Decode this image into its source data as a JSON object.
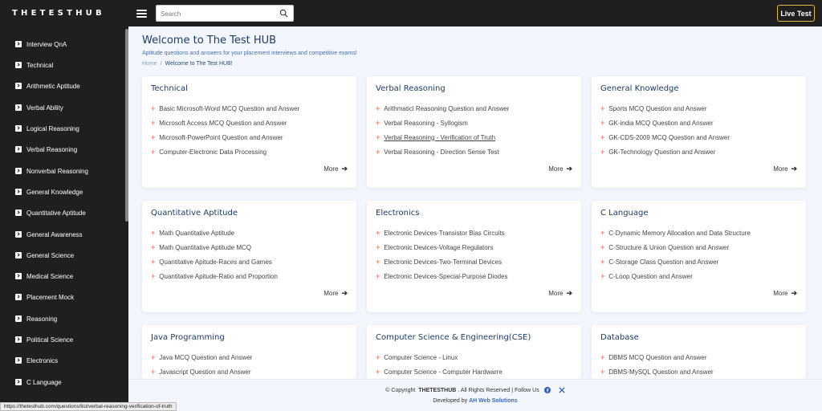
{
  "header": {
    "logo": "THETESTHUB",
    "search_placeholder": "Search",
    "live_test_label": "Live Test"
  },
  "sidebar": {
    "items": [
      {
        "label": "Interview QnA"
      },
      {
        "label": "Technical"
      },
      {
        "label": "Arithmetic Aptitude"
      },
      {
        "label": "Verbal Ability"
      },
      {
        "label": "Logical Reasoning"
      },
      {
        "label": "Verbal Reasoning"
      },
      {
        "label": "Nonverbal Reasoning"
      },
      {
        "label": "General Knowledge"
      },
      {
        "label": "Quantitative Aptitude"
      },
      {
        "label": "General Awareness"
      },
      {
        "label": "General Science"
      },
      {
        "label": "Medical Science"
      },
      {
        "label": "Placement Mock"
      },
      {
        "label": "Reasoning"
      },
      {
        "label": "Political Science"
      },
      {
        "label": "Electronics"
      },
      {
        "label": "C Language"
      }
    ]
  },
  "main": {
    "title": "Welcome to The Test HUB",
    "subtitle": "Aptitude questions and answers for your placement interviews and competitive exams!",
    "breadcrumb": {
      "home": "Home",
      "separator": "/",
      "current": "Welcome to The Test HUB!"
    },
    "more_label": "More",
    "cards": [
      {
        "title": "Technical",
        "items": [
          "Basic Microsoft-Word MCQ Question and Answer",
          "Microsoft Access MCQ Question and Answer",
          "Microsoft-PowerPoint Question and Answer",
          "Computer-Electronic Data Processing"
        ]
      },
      {
        "title": "Verbal Reasoning",
        "items": [
          "Arithmaticl Reasoning Question and Answer",
          "Verbal Reasoning - Syllogism",
          "Verbal Reasoning - Verification of Truth",
          "Verbal Reasoning - Direction Sense Test"
        ]
      },
      {
        "title": "General Knowledge",
        "items": [
          "Sports MCQ Question and Answer",
          "GK-india MCQ Question and Answer",
          "GK-CDS-2009 MCQ Question and Answer",
          "GK-Technology Question and Answer"
        ]
      },
      {
        "title": "Quantitative Aptitude",
        "items": [
          "Math Quantitative Aptitude",
          "Math Quantitative Aptitude MCQ",
          "Quantitative Apitude-Races and Games",
          "Quantitative Apitude-Ratio and Proportion"
        ]
      },
      {
        "title": "Electronics",
        "items": [
          "Electronic Devices-Transistor Bias Circuits",
          "Electronic Devices-Voltage Regulators",
          "Electronic Devices-Two-Terminal Devices",
          "Electronic Devices-Special-Purpose Diodes"
        ]
      },
      {
        "title": "C Language",
        "items": [
          "C-Dynamic Memory Allocation and Data Structure",
          "C-Structure & Union Question and Answer",
          "C-Storage Class Question and Answer",
          "C-Loop Question and Answer"
        ]
      },
      {
        "title": "Java Programming",
        "items": [
          "Java MCQ Question and Answer",
          "Javascript Question and Answer"
        ]
      },
      {
        "title": "Computer Science & Engineering(CSE)",
        "items": [
          "Computer Science - Linux",
          "Computer Science - Computer Hardwarre"
        ]
      },
      {
        "title": "Database",
        "items": [
          "DBMS MCQ Question and Answer",
          "DBMS-MySQL Question and Answer"
        ]
      }
    ]
  },
  "footer": {
    "copyright_prefix": "© Copyright",
    "brand": "THETESTHUB",
    "copyright_suffix": ". All Rights Reserved | Follow Us",
    "developed_prefix": "Developed by",
    "developer": "AH Web Solutions"
  },
  "status_bar": {
    "url": "https://thetesthub.com/questions/list/verbal-reasoning-verification-of-truth"
  },
  "colors": {
    "dark_bg": "#1f1f1f",
    "accent_gold": "#e2b93b",
    "title_blue": "#1d3b66",
    "bullet_red": "#f08a7a",
    "page_bg": "#f3f6fc"
  }
}
